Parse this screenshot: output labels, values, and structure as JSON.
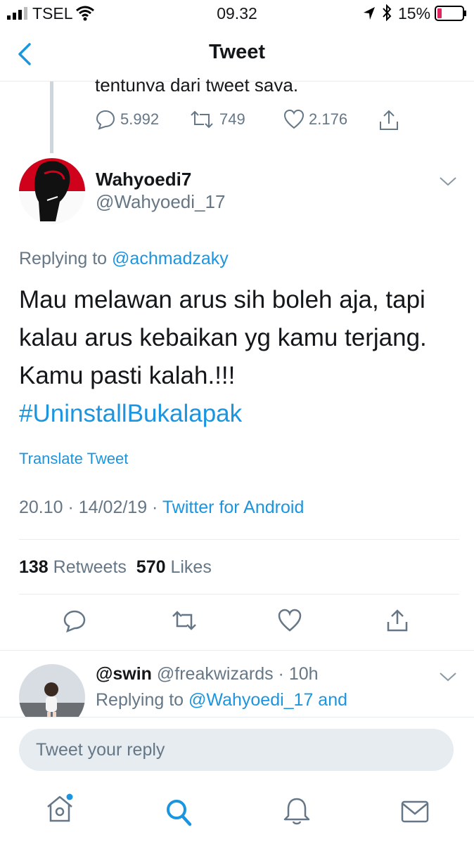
{
  "status_bar": {
    "carrier": "TSEL",
    "time": "09.32",
    "battery": "15%"
  },
  "nav": {
    "title": "Tweet",
    "back_icon": "chevron-left-icon"
  },
  "prior_tweet": {
    "cropped_text": "tentunya dari tweet saya.",
    "replies": "5.992",
    "retweets": "749",
    "likes": "2.176"
  },
  "tweet": {
    "display_name": "Wahyoedi7",
    "handle": "@Wahyoedi_17",
    "replying_prefix": "Replying to ",
    "replying_to": "@achmadzaky",
    "text_lines": [
      "Mau melawan arus sih boleh aja, tapi",
      "kalau arus kebaikan yg kamu terjang.",
      "Kamu pasti kalah.!!!"
    ],
    "hashtag": "#UninstallBukalapak",
    "translate_label": "Translate Tweet",
    "time": "20.10",
    "date": "14/02/19",
    "source": "Twitter for Android",
    "retweet_count": "138",
    "retweet_label": "Retweets",
    "like_count": "570",
    "like_label": "Likes"
  },
  "reply": {
    "name": "@swin",
    "handle": "@freakwizards",
    "age": "10h",
    "replying_prefix": "Replying to ",
    "replying_to": "@Wahyoedi_17 and"
  },
  "compose": {
    "placeholder": "Tweet your reply"
  },
  "tabs": [
    "home-icon",
    "search-icon",
    "notifications-icon",
    "messages-icon"
  ],
  "colors": {
    "accent": "#1b95e0",
    "muted": "#657786",
    "text": "#14171a",
    "divider": "#e6ecf0"
  }
}
